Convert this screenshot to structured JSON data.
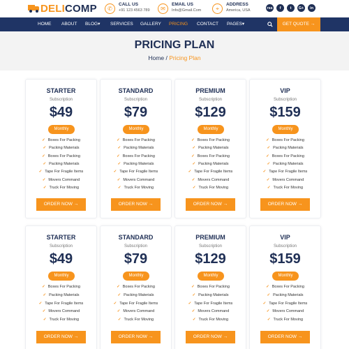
{
  "brand": {
    "part1": "DELI",
    "part2": "COMP"
  },
  "contacts": [
    {
      "icon": "phone-icon",
      "glyph": "✆",
      "title": "CALL US",
      "value": "+91 123 4563 789"
    },
    {
      "icon": "email-icon",
      "glyph": "✉",
      "title": "EMAIL US",
      "value": "Info@Gmail.Com"
    },
    {
      "icon": "location-icon",
      "glyph": "⌖",
      "title": "ADDRESS",
      "value": "America, USA"
    }
  ],
  "socials": [
    {
      "icon": "rss-icon",
      "glyph": "rss"
    },
    {
      "icon": "facebook-icon",
      "glyph": "f"
    },
    {
      "icon": "twitter-icon",
      "glyph": "t"
    },
    {
      "icon": "google-plus-icon",
      "glyph": "G+"
    },
    {
      "icon": "linkedin-icon",
      "glyph": "in"
    }
  ],
  "nav": {
    "items": [
      "HOME",
      "ABOUT",
      "BLOG",
      "SERVICES",
      "GALLERY",
      "PRICING",
      "CONTACT",
      "PAGES"
    ],
    "active": "PRICING",
    "dropdowns": [
      "BLOG",
      "PAGES"
    ],
    "quote_label": "GET QUOTE"
  },
  "hero": {
    "title": "PRICING PLAN",
    "crumb_home": "Home",
    "crumb_sep": "/",
    "crumb_current": "Pricing Plan"
  },
  "plans_rows": [
    [
      {
        "name": "STARTER",
        "sub": "Subscription",
        "price": "$49",
        "badge": "Monthly",
        "features": [
          "Boxes For Packing",
          "Packing Materials",
          "Boxes For Packing",
          "Packing Materials",
          "Tape For Fragile Items",
          "Movers Command",
          "Truck For Moving"
        ],
        "button": "ORDER NOW"
      },
      {
        "name": "STANDARD",
        "sub": "Subscription",
        "price": "$79",
        "badge": "Monthly",
        "features": [
          "Boxes For Packing",
          "Packing Materials",
          "Boxes For Packing",
          "Packing Materials",
          "Tape For Fragile Items",
          "Movers Command",
          "Truck For Moving"
        ],
        "button": "ORDER NOW"
      },
      {
        "name": "PREMIUM",
        "sub": "Subscription",
        "price": "$129",
        "badge": "Monthly",
        "features": [
          "Boxes For Packing",
          "Packing Materials",
          "Boxes For Packing",
          "Packing Materials",
          "Tape For Fragile Items",
          "Movers Command",
          "Truck For Moving"
        ],
        "button": "ORDER NOW"
      },
      {
        "name": "VIP",
        "sub": "Subscription",
        "price": "$159",
        "badge": "Monthly",
        "features": [
          "Boxes For Packing",
          "Packing Materials",
          "Boxes For Packing",
          "Packing Materials",
          "Tape For Fragile Items",
          "Movers Command",
          "Truck For Moving"
        ],
        "button": "ORDER NOW"
      }
    ],
    [
      {
        "name": "STARTER",
        "sub": "Subscription",
        "price": "$49",
        "badge": "Monthly",
        "features": [
          "Boxes For Packing",
          "Packing Materials",
          "Tape For Fragile Items",
          "Movers Command",
          "Truck For Moving"
        ],
        "button": "ORDER NOW"
      },
      {
        "name": "STANDARD",
        "sub": "Subscription",
        "price": "$79",
        "badge": "Monthly",
        "features": [
          "Boxes For Packing",
          "Packing Materials",
          "Tape For Fragile Items",
          "Movers Command",
          "Truck For Moving"
        ],
        "button": "ORDER NOW"
      },
      {
        "name": "PREMIUM",
        "sub": "Subscription",
        "price": "$129",
        "badge": "Monthly",
        "features": [
          "Boxes For Packing",
          "Packing Materials",
          "Tape For Fragile Items",
          "Movers Command",
          "Truck For Moving"
        ],
        "button": "ORDER NOW"
      },
      {
        "name": "VIP",
        "sub": "Subscription",
        "price": "$159",
        "badge": "Monthly",
        "features": [
          "Boxes For Packing",
          "Packing Materials",
          "Tape For Fragile Items",
          "Movers Command",
          "Truck For Moving"
        ],
        "button": "ORDER NOW"
      }
    ]
  ],
  "colors": {
    "accent": "#f7941d",
    "navy": "#1f3465",
    "text": "#1f2f55",
    "hero_bg": "#f3f3f3"
  }
}
